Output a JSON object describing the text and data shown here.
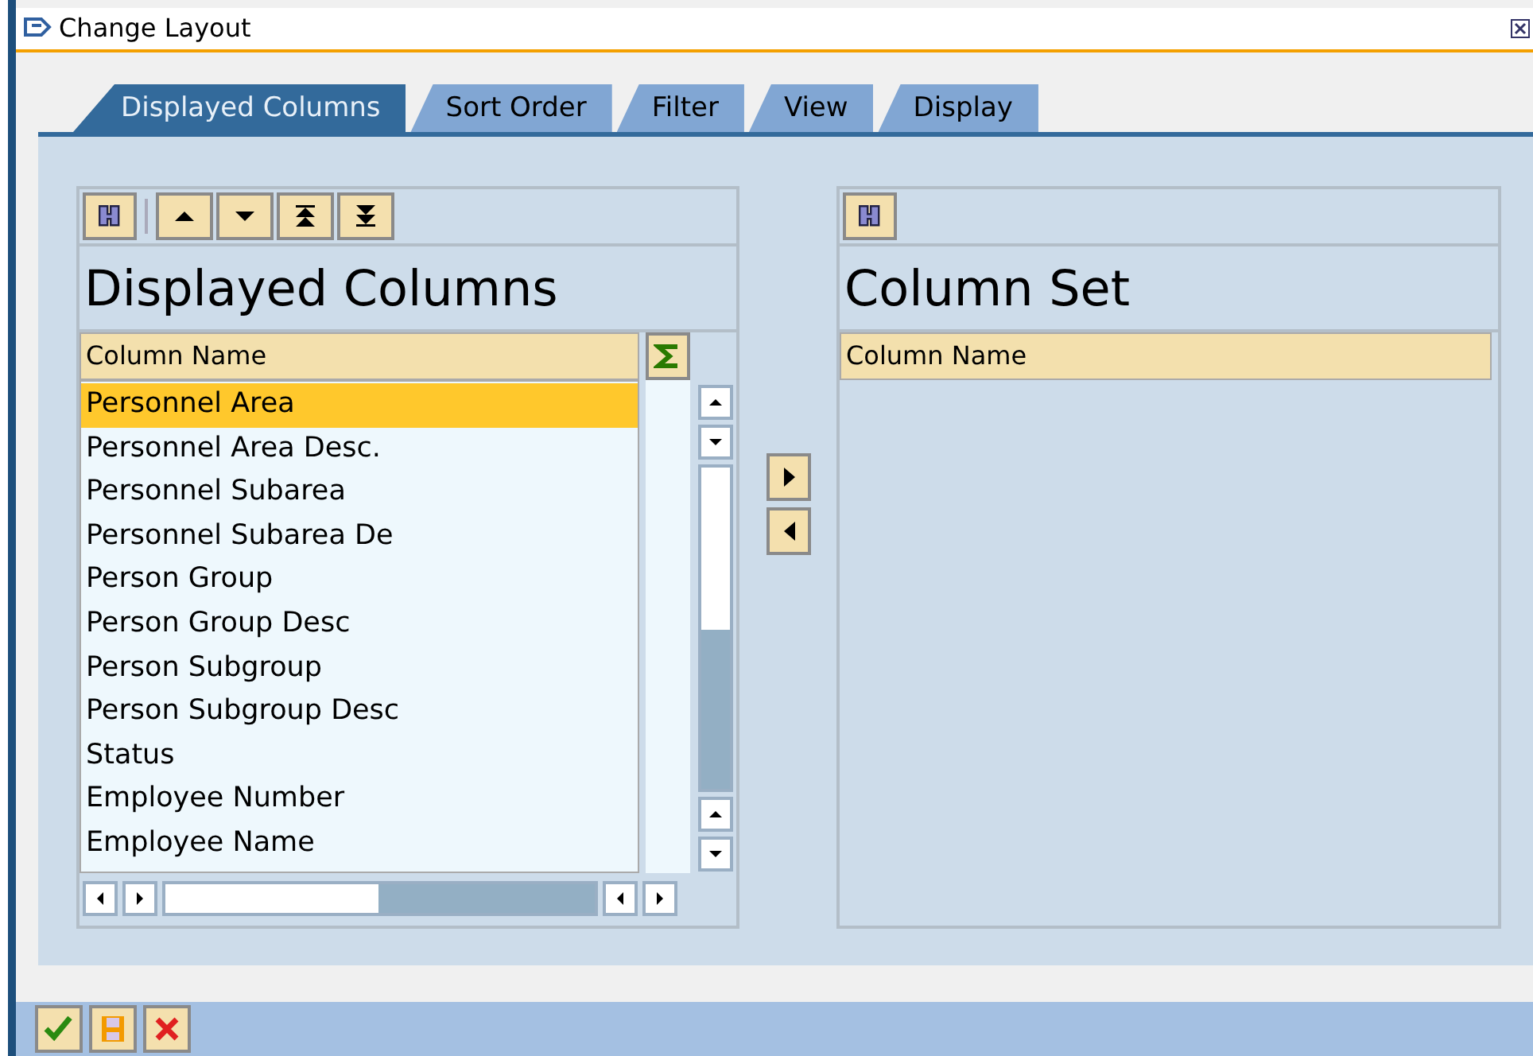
{
  "window": {
    "title": "Change Layout"
  },
  "tabs": [
    {
      "label": "Displayed Columns",
      "selected": true
    },
    {
      "label": "Sort Order",
      "selected": false
    },
    {
      "label": "Filter",
      "selected": false
    },
    {
      "label": "View",
      "selected": false
    },
    {
      "label": "Display",
      "selected": false
    }
  ],
  "displayed_columns": {
    "title": "Displayed Columns",
    "column_header": "Column Name",
    "rows": [
      {
        "label": "Personnel Area",
        "selected": true
      },
      {
        "label": "Personnel Area Desc.",
        "selected": false
      },
      {
        "label": "Personnel Subarea",
        "selected": false
      },
      {
        "label": "Personnel Subarea De",
        "selected": false
      },
      {
        "label": "Person Group",
        "selected": false
      },
      {
        "label": "Person Group Desc",
        "selected": false
      },
      {
        "label": "Person Subgroup",
        "selected": false
      },
      {
        "label": "Person Subgroup Desc",
        "selected": false
      },
      {
        "label": "Status",
        "selected": false
      },
      {
        "label": "Employee Number",
        "selected": false
      },
      {
        "label": "Employee Name",
        "selected": false
      }
    ]
  },
  "column_set": {
    "title": "Column Set",
    "column_header": "Column Name"
  }
}
